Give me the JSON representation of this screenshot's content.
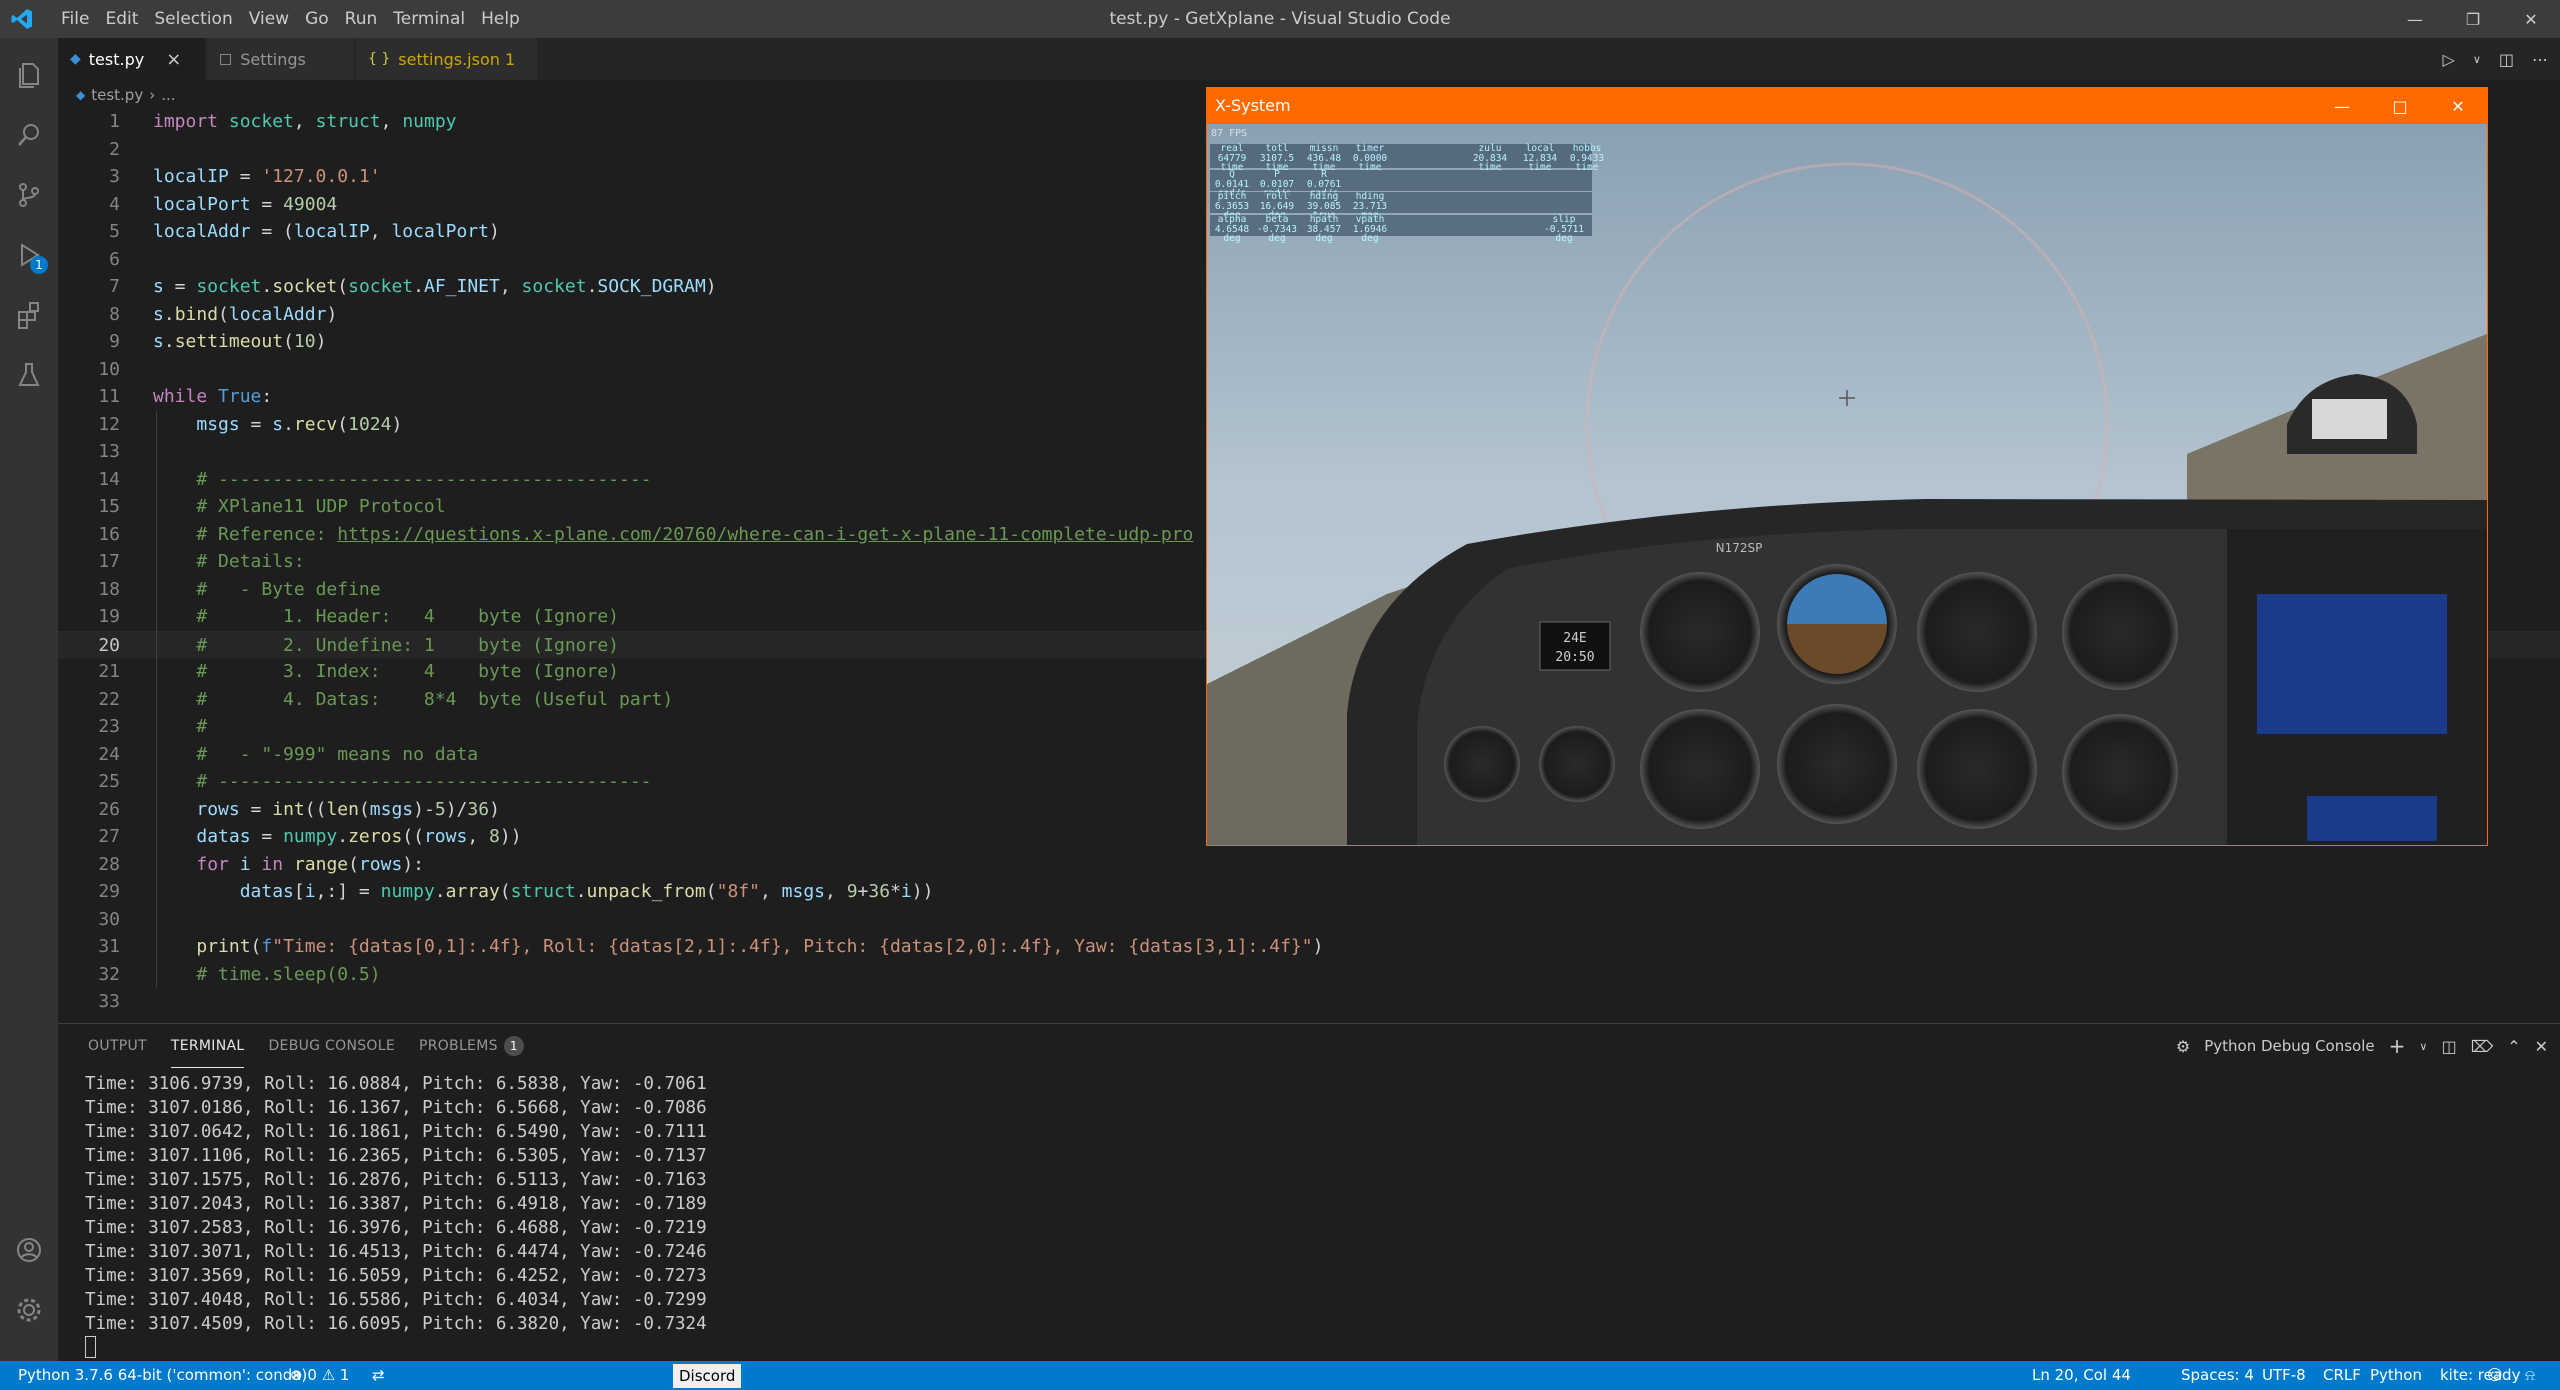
{
  "titlebar": {
    "menus": [
      "File",
      "Edit",
      "Selection",
      "View",
      "Go",
      "Run",
      "Terminal",
      "Help"
    ],
    "title": "test.py - GetXplane - Visual Studio Code"
  },
  "tabs": [
    {
      "label": "test.py",
      "icon": "python-icon",
      "active": true
    },
    {
      "label": "Settings",
      "icon": "settings-file-icon",
      "active": false
    },
    {
      "label": "settings.json 1",
      "icon": "json-icon",
      "active": false
    }
  ],
  "breadcrumb": {
    "file": "test.py",
    "rest": "..."
  },
  "editor": {
    "current_line": 20,
    "lines": [
      "import socket, struct, numpy",
      "",
      "localIP = '127.0.0.1'",
      "localPort = 49004",
      "localAddr = (localIP, localPort)",
      "",
      "s = socket.socket(socket.AF_INET, socket.SOCK_DGRAM)",
      "s.bind(localAddr)",
      "s.settimeout(10)",
      "",
      "while True:",
      "    msgs = s.recv(1024)",
      "",
      "    # ----------------------------------------",
      "    # XPlane11 UDP Protocol",
      "    # Reference: https://questions.x-plane.com/20760/where-can-i-get-x-plane-11-complete-udp-pro",
      "    # Details:",
      "    #   - Byte define",
      "    #       1. Header:   4    byte (Ignore)",
      "    #       2. Undefine: 1    byte (Ignore)",
      "    #       3. Index:    4    byte (Ignore)",
      "    #       4. Datas:    8*4  byte (Useful part)",
      "    #",
      "    #   - \"-999\" means no data",
      "    # ----------------------------------------",
      "    rows = int((len(msgs)-5)/36)",
      "    datas = numpy.zeros((rows, 8))",
      "    for i in range(rows):",
      "        datas[i,:] = numpy.array(struct.unpack_from(\"8f\", msgs, 9+36*i))",
      "",
      "    print(f\"Time: {datas[0,1]:.4f}, Roll: {datas[2,1]:.4f}, Pitch: {datas[2,0]:.4f}, Yaw: {datas[3,1]:.4f}\")",
      "    # time.sleep(0.5)",
      ""
    ]
  },
  "panel": {
    "tabs": [
      "OUTPUT",
      "TERMINAL",
      "DEBUG CONSOLE",
      "PROBLEMS"
    ],
    "active_tab": "TERMINAL",
    "problems_count": "1",
    "console_name": "Python Debug Console",
    "terminal_lines": [
      "Time: 3106.9739, Roll: 16.0884, Pitch: 6.5838, Yaw: -0.7061",
      "Time: 3107.0186, Roll: 16.1367, Pitch: 6.5668, Yaw: -0.7086",
      "Time: 3107.0642, Roll: 16.1861, Pitch: 6.5490, Yaw: -0.7111",
      "Time: 3107.1106, Roll: 16.2365, Pitch: 6.5305, Yaw: -0.7137",
      "Time: 3107.1575, Roll: 16.2876, Pitch: 6.5113, Yaw: -0.7163",
      "Time: 3107.2043, Roll: 16.3387, Pitch: 6.4918, Yaw: -0.7189",
      "Time: 3107.2583, Roll: 16.3976, Pitch: 6.4688, Yaw: -0.7219",
      "Time: 3107.3071, Roll: 16.4513, Pitch: 6.4474, Yaw: -0.7246",
      "Time: 3107.3569, Roll: 16.5059, Pitch: 6.4252, Yaw: -0.7273",
      "Time: 3107.4048, Roll: 16.5586, Pitch: 6.4034, Yaw: -0.7299",
      "Time: 3107.4509, Roll: 16.6095, Pitch: 6.3820, Yaw: -0.7324"
    ]
  },
  "statusbar": {
    "interpreter": "Python 3.7.6 64-bit ('common': conda)",
    "errors": "0",
    "warnings": "1",
    "discord": "Discord",
    "position": "Ln 20, Col 44",
    "spaces": "Spaces: 4",
    "encoding": "UTF-8",
    "eol": "CRLF",
    "language": "Python",
    "kite": "kite: ready"
  },
  "xsystem": {
    "title": "X-System",
    "fps": "87 FPS",
    "hud_rows": [
      {
        "cols": [
          [
            "real",
            "64779",
            "time"
          ],
          [
            "totl",
            "3107.5",
            "time"
          ],
          [
            "missn",
            "436.48",
            "time"
          ],
          [
            "timer",
            "0.0000",
            "time"
          ],
          [
            "zulu",
            "20.834",
            "time"
          ],
          [
            "local",
            "12.834",
            "time"
          ],
          [
            "hobbs",
            "0.9433",
            "time"
          ]
        ]
      },
      {
        "cols": [
          [
            "Q",
            "0.0141",
            "rad/s"
          ],
          [
            "P",
            "0.0107",
            "rad/s"
          ],
          [
            "R",
            "0.0761",
            "rad/s"
          ]
        ]
      },
      {
        "cols": [
          [
            "pitch",
            "6.3653",
            "deg"
          ],
          [
            "roll",
            "16.649",
            "deg"
          ],
          [
            "hding",
            "39.085",
            "true"
          ],
          [
            "hding",
            "23.713",
            "mag"
          ]
        ]
      },
      {
        "cols": [
          [
            "alpha",
            "4.6548",
            "deg"
          ],
          [
            "beta",
            "-0.7343",
            "deg"
          ],
          [
            "hpath",
            "38.457",
            "deg"
          ],
          [
            "vpath",
            "1.6946",
            "deg"
          ],
          [
            "slip",
            "-0.5711",
            "deg"
          ]
        ]
      }
    ],
    "clock_top": "24E",
    "clock_bottom": "20:50",
    "tail_number": "N172SP",
    "colors": {
      "title_bar": "#ff6a00",
      "sky": "#8aa4b8",
      "panel": "#2b2b2b"
    }
  },
  "colors": {
    "accent": "#007acc",
    "editor_bg": "#1e1e1e",
    "activity_bg": "#333333"
  }
}
